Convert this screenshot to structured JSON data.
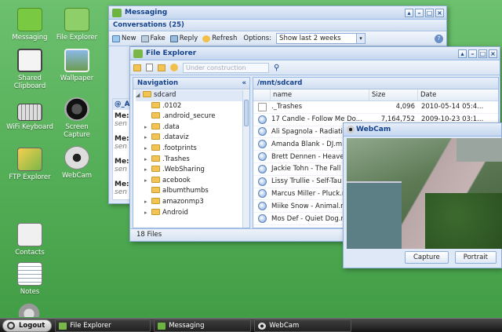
{
  "desktop": {
    "icons": [
      {
        "label": "Messaging",
        "icon": "messaging-icon"
      },
      {
        "label": "File Explorer",
        "icon": "file-explorer-icon"
      },
      {
        "label": "Shared Clipboard",
        "icon": "clipboard-icon"
      },
      {
        "label": "Wallpaper",
        "icon": "wallpaper-icon"
      },
      {
        "label": "WiFi Keyboard",
        "icon": "keyboard-icon"
      },
      {
        "label": "Screen Capture",
        "icon": "camera-lens-icon"
      },
      {
        "label": "FTP Explorer",
        "icon": "ftp-icon"
      },
      {
        "label": "WebCam",
        "icon": "webcam-icon"
      },
      {
        "label": "Contacts",
        "icon": "contacts-icon"
      },
      {
        "label": "Notes",
        "icon": "notes-icon"
      }
    ]
  },
  "messaging": {
    "title": "Messaging",
    "section": "Conversations (25)",
    "toolbar": {
      "new": "New",
      "fake": "Fake",
      "reply": "Reply",
      "refresh": "Refresh",
      "options_label": "Options:",
      "options_value": "Show last 2 weeks"
    },
    "contact_header": "@_A",
    "messages": [
      {
        "title": "Me:",
        "sub": "sen"
      },
      {
        "title": "Me:",
        "sub": "sen"
      },
      {
        "title": "Me:",
        "sub": "sen"
      },
      {
        "title": "Me:",
        "sub": "sen"
      }
    ]
  },
  "file_explorer": {
    "title": "File Explorer",
    "path_placeholder": "Under construction",
    "nav_header": "Navigation",
    "nav_collapse": "«",
    "path": "/mnt/sdcard",
    "tree": [
      {
        "label": "sdcard",
        "level": 0,
        "arrow": "◢"
      },
      {
        "label": ".0102",
        "level": 1,
        "arrow": ""
      },
      {
        "label": ".android_secure",
        "level": 1,
        "arrow": ""
      },
      {
        "label": ".data",
        "level": 1,
        "arrow": "▸"
      },
      {
        "label": ".dataviz",
        "level": 1,
        "arrow": "▸"
      },
      {
        "label": ".footprints",
        "level": 1,
        "arrow": "▸"
      },
      {
        "label": ".Trashes",
        "level": 1,
        "arrow": "▸"
      },
      {
        "label": ".WebSharing",
        "level": 1,
        "arrow": "▸"
      },
      {
        "label": "acebook",
        "level": 1,
        "arrow": "▸"
      },
      {
        "label": "albumthumbs",
        "level": 1,
        "arrow": ""
      },
      {
        "label": "amazonmp3",
        "level": 1,
        "arrow": "▸"
      },
      {
        "label": "Android",
        "level": 1,
        "arrow": "▸"
      }
    ],
    "columns": {
      "name": "name",
      "size": "Size",
      "date": "Date"
    },
    "files": [
      {
        "name": "._Trashes",
        "size": "4,096",
        "date": "2010-05-14 05:4...",
        "type": "doc"
      },
      {
        "name": "17 Candle - Follow Me Do...",
        "size": "7,164,752",
        "date": "2009-10-23 03:1...",
        "type": "audio"
      },
      {
        "name": "Ali Spagnola - Radiati",
        "size": "",
        "date": "",
        "type": "audio"
      },
      {
        "name": "Amanda Blank - DJ.m",
        "size": "",
        "date": "",
        "type": "audio"
      },
      {
        "name": "Brett Dennen - Heave",
        "size": "",
        "date": "",
        "type": "audio"
      },
      {
        "name": "Jackie Tohn - The Fall",
        "size": "",
        "date": "",
        "type": "audio"
      },
      {
        "name": "Lissy Trullie - Self-Tau",
        "size": "",
        "date": "",
        "type": "audio"
      },
      {
        "name": "Marcus Miller - Pluck.n",
        "size": "",
        "date": "",
        "type": "audio"
      },
      {
        "name": "Miike Snow - Animal.n",
        "size": "",
        "date": "",
        "type": "audio"
      },
      {
        "name": "Mos Def - Quiet Dog.n",
        "size": "",
        "date": "",
        "type": "audio"
      }
    ],
    "status": "18 Files"
  },
  "webcam": {
    "title": "WebCam",
    "capture": "Capture",
    "portrait": "Portrait"
  },
  "taskbar": {
    "logout": "Logout",
    "tasks": [
      "File Explorer",
      "Messaging",
      "WebCam"
    ]
  },
  "window_controls": {
    "pin": "▴",
    "min": "–",
    "max": "□",
    "close": "×"
  },
  "colors": {
    "accent": "#15428b",
    "window_bg": "#dfe8f6",
    "desktop": "#53ad56"
  }
}
